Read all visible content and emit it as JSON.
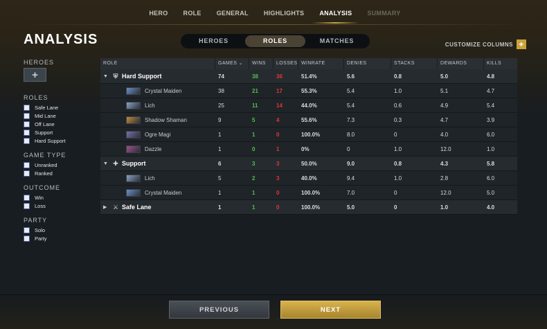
{
  "nav": {
    "tabs": [
      {
        "label": "HERO",
        "state": "normal"
      },
      {
        "label": "ROLE",
        "state": "normal"
      },
      {
        "label": "GENERAL",
        "state": "normal"
      },
      {
        "label": "HIGHLIGHTS",
        "state": "normal"
      },
      {
        "label": "ANALYSIS",
        "state": "active"
      },
      {
        "label": "SUMMARY",
        "state": "dim"
      }
    ]
  },
  "page": {
    "title": "ANALYSIS",
    "customize_label": "CUSTOMIZE COLUMNS",
    "customize_icon": "+"
  },
  "segment": {
    "items": [
      {
        "label": "HEROES",
        "active": false
      },
      {
        "label": "ROLES",
        "active": true
      },
      {
        "label": "MATCHES",
        "active": false
      }
    ]
  },
  "sidebar": {
    "heroes_label": "HEROES",
    "hero_add_icon": "+",
    "roles_label": "ROLES",
    "roles": [
      "Safe Lane",
      "Mid Lane",
      "Off Lane",
      "Support",
      "Hard Support"
    ],
    "game_type_label": "GAME TYPE",
    "game_types": [
      "Unranked",
      "Ranked"
    ],
    "outcome_label": "OUTCOME",
    "outcomes": [
      "Win",
      "Loss"
    ],
    "party_label": "PARTY",
    "parties": [
      "Solo",
      "Party"
    ]
  },
  "table": {
    "columns": {
      "role": "ROLE",
      "games": "GAMES ⌄",
      "wins": "WINS",
      "losses": "LOSSES",
      "winrate": "WINRATE",
      "denies": "DENIES",
      "stacks": "STACKS",
      "dewards": "DEWARDS",
      "kills": "KILLS"
    },
    "groups": [
      {
        "name": "Hard Support",
        "expanded": true,
        "caret": "▼",
        "icon": "hard-support-icon",
        "games": "74",
        "wins": "38",
        "losses": "36",
        "winrate": "51.4%",
        "denies": "5.6",
        "stacks": "0.8",
        "dewards": "5.0",
        "kills": "4.8",
        "heroes": [
          {
            "name": "Crystal Maiden",
            "color": "#6d8fc9",
            "games": "38",
            "wins": "21",
            "losses": "17",
            "winrate": "55.3%",
            "denies": "5.4",
            "stacks": "1.0",
            "dewards": "5.1",
            "kills": "4.7"
          },
          {
            "name": "Lich",
            "color": "#8aa3c4",
            "games": "25",
            "wins": "11",
            "losses": "14",
            "winrate": "44.0%",
            "denies": "5.4",
            "stacks": "0.6",
            "dewards": "4.9",
            "kills": "5.4"
          },
          {
            "name": "Shadow Shaman",
            "color": "#c08a3a",
            "games": "9",
            "wins": "5",
            "losses": "4",
            "winrate": "55.6%",
            "denies": "7.3",
            "stacks": "0.3",
            "dewards": "4.7",
            "kills": "3.9"
          },
          {
            "name": "Ogre Magi",
            "color": "#7a6fa8",
            "games": "1",
            "wins": "1",
            "losses": "0",
            "winrate": "100.0%",
            "denies": "8.0",
            "stacks": "0",
            "dewards": "4.0",
            "kills": "6.0"
          },
          {
            "name": "Dazzle",
            "color": "#a04f8c",
            "games": "1",
            "wins": "0",
            "losses": "1",
            "winrate": "0%",
            "denies": "0",
            "stacks": "1.0",
            "dewards": "12.0",
            "kills": "1.0"
          }
        ]
      },
      {
        "name": "Support",
        "expanded": true,
        "caret": "▼",
        "icon": "support-icon",
        "games": "6",
        "wins": "3",
        "losses": "3",
        "winrate": "50.0%",
        "denies": "9.0",
        "stacks": "0.8",
        "dewards": "4.3",
        "kills": "5.8",
        "heroes": [
          {
            "name": "Lich",
            "color": "#8aa3c4",
            "games": "5",
            "wins": "2",
            "losses": "3",
            "winrate": "40.0%",
            "denies": "9.4",
            "stacks": "1.0",
            "dewards": "2.8",
            "kills": "6.0"
          },
          {
            "name": "Crystal Maiden",
            "color": "#6d8fc9",
            "games": "1",
            "wins": "1",
            "losses": "0",
            "winrate": "100.0%",
            "denies": "7.0",
            "stacks": "0",
            "dewards": "12.0",
            "kills": "5.0"
          }
        ]
      },
      {
        "name": "Safe Lane",
        "expanded": false,
        "caret": "▶",
        "icon": "safe-lane-icon",
        "games": "1",
        "wins": "1",
        "losses": "0",
        "winrate": "100.0%",
        "denies": "5.0",
        "stacks": "0",
        "dewards": "1.0",
        "kills": "4.0",
        "heroes": []
      }
    ]
  },
  "footer": {
    "previous_label": "PREVIOUS",
    "next_label": "NEXT"
  }
}
